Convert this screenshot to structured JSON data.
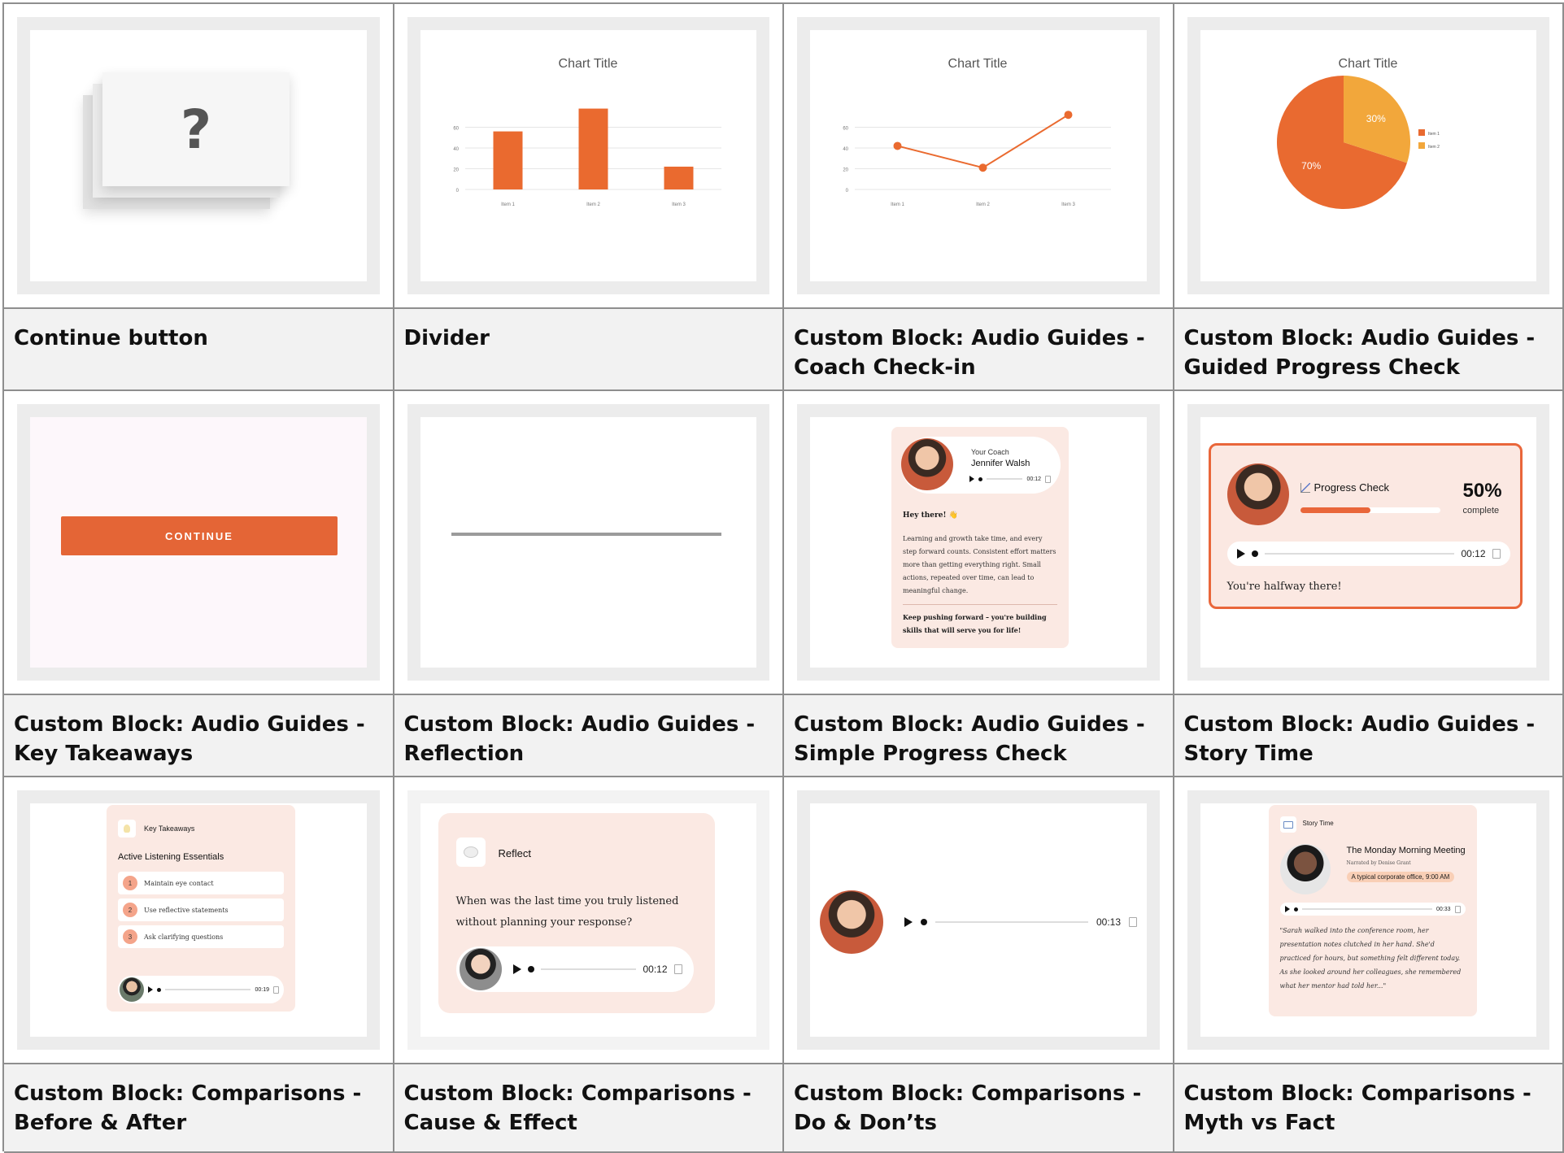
{
  "labels": {
    "r1": [
      "Continue button",
      "Divider",
      "Custom Block: Audio Guides - Coach Check-in",
      "Custom Block: Audio Guides - Guided Progress Check"
    ],
    "r2": [
      "Custom Block: Audio Guides - Key Takeaways",
      "Custom Block: Audio Guides - Reflection",
      "Custom Block: Audio Guides - Simple Progress Check",
      "Custom Block: Audio Guides - Story Time"
    ],
    "r3": [
      "Custom Block: Comparisons - Before & After",
      "Custom Block: Comparisons - Cause & Effect",
      "Custom Block: Comparisons - Do & Don’ts",
      "Custom Block: Comparisons - Myth vs Fact"
    ]
  },
  "placeholder": {
    "glyph": "?"
  },
  "chart_data": [
    {
      "type": "bar",
      "title": "Chart Title",
      "categories": [
        "Item 1",
        "Item 2",
        "Item 3"
      ],
      "values": [
        56,
        78,
        22
      ],
      "yticks": [
        "0",
        "20",
        "40",
        "60"
      ],
      "ylim": [
        0,
        80
      ],
      "grid": true,
      "color": "#ea6a2f"
    },
    {
      "type": "line",
      "title": "Chart Title",
      "categories": [
        "Item 1",
        "Item 2",
        "Item 3"
      ],
      "values": [
        42,
        21,
        72
      ],
      "yticks": [
        "0",
        "20",
        "40",
        "60"
      ],
      "ylim": [
        0,
        80
      ],
      "grid": true,
      "color": "#ea6a2f"
    },
    {
      "type": "pie",
      "title": "Chart Title",
      "slices": [
        {
          "name": "Item 1",
          "value": 70,
          "label": "70%",
          "color": "#e96a30"
        },
        {
          "name": "Item 2",
          "value": 30,
          "label": "30%",
          "color": "#f2a73b"
        }
      ],
      "legend": "right"
    }
  ],
  "continue": {
    "label": "CONTINUE",
    "color": "#e46536"
  },
  "coach": {
    "kicker": "Your Coach",
    "name": "Jennifer Walsh",
    "time": "00:12",
    "greeting": "Hey there! 👋",
    "body": "Learning and growth take time, and every step forward counts. Consistent effort matters more than getting everything right. Small actions, repeated over time, can lead to meaningful change.",
    "closing": "Keep pushing forward – you're building skills that will serve you for life!"
  },
  "progress": {
    "title": "Progress Check",
    "percent": "50%",
    "percent_value": 50,
    "complete": "complete",
    "time": "00:12",
    "message": "You're halfway there!",
    "accent": "#e9663a"
  },
  "takeaways": {
    "kicker": "Key Takeaways",
    "title": "Active Listening Essentials",
    "items": [
      {
        "num": "1",
        "text": "Maintain eye contact"
      },
      {
        "num": "2",
        "text": "Use reflective statements"
      },
      {
        "num": "3",
        "text": "Ask clarifying questions"
      }
    ],
    "time": "00:19"
  },
  "reflect": {
    "title": "Reflect",
    "question": "When was the last time you truly listened without planning your response?",
    "time": "00:12"
  },
  "simple": {
    "time": "00:13"
  },
  "story": {
    "kicker": "Story Time",
    "title": "The Monday Morning Meeting",
    "narrator": "Narrated by Denise Grant",
    "tag": "A typical corporate office, 9:00 AM",
    "time": "00:33",
    "text": "\"Sarah walked into the conference room, her presentation notes clutched in her hand. She'd practiced for hours, but something felt different today. As she looked around her colleagues, she remembered what her mentor had told her...\""
  }
}
